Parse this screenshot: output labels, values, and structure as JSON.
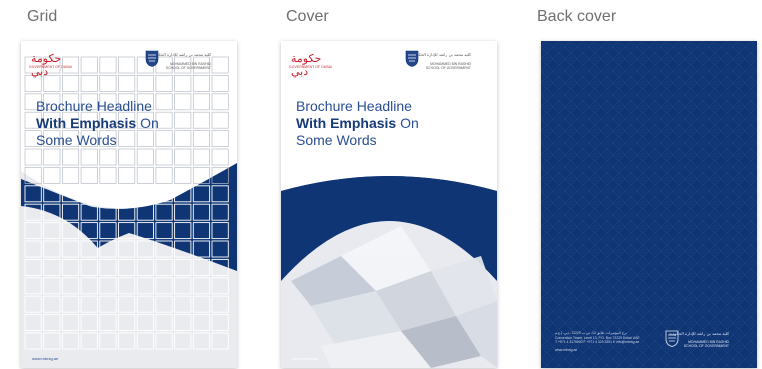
{
  "labels": {
    "grid": "Grid",
    "cover": "Cover",
    "back": "Back cover"
  },
  "brochure": {
    "line1": "Brochure Headline",
    "line2_em": "With Emphasis",
    "line2_rest": " On",
    "line3": "Some Words"
  },
  "logos": {
    "gov_script": "حكومة دبي",
    "gov_text": "GOVERNMENT OF DUBAI",
    "mbr_arabic": "كلية محمد بن راشد للإدارة الحكومية",
    "mbr_en_line1": "MOHAMMED BIN RASHID",
    "mbr_en_line2": "SCHOOL OF GOVERNMENT"
  },
  "website": "www.mbrsg.ae",
  "back_cover": {
    "address_arabic": "برج المؤتمرات، طابق 13، ص.ب 72229، دبي، إ.ع.م",
    "address_en": "Convention Tower, Level 13, P.O. Box 72229 Dubai UAE",
    "contact": "T +971 4 3175500  F +971 4 329 3291  E info@mbrsg.ae",
    "url": "www.mbrsg.ae"
  },
  "colors": {
    "navy": "#0f3574",
    "light_grey": "#e9ebef",
    "brand_red": "#c61f2c",
    "headline_blue": "#2a4f93"
  }
}
